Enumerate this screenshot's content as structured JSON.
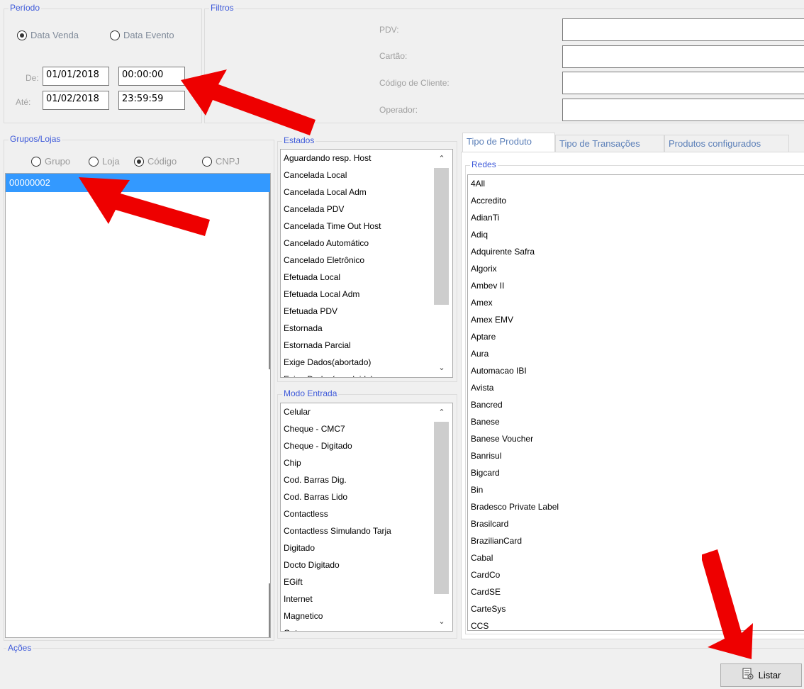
{
  "periodo": {
    "title": "Período",
    "options": [
      "Data Venda",
      "Data Evento"
    ],
    "selected": "Data Venda",
    "de_label": "De:",
    "ate_label": "Até:",
    "de_date": "01/01/2018",
    "de_time": "00:00:00",
    "ate_date": "01/02/2018",
    "ate_time": "23:59:59"
  },
  "filtros": {
    "title": "Filtros",
    "pdv_label": "PDV:",
    "cartao_label": "Cartão:",
    "codigo_label": "Código de Cliente:",
    "operador_label": "Operador:",
    "pdv_value": "",
    "cartao_value": "",
    "codigo_value": "",
    "operador_value": ""
  },
  "grupos": {
    "title": "Grupos/Lojas",
    "options": [
      "Grupo",
      "Loja",
      "Código",
      "CNPJ"
    ],
    "selected": "Código",
    "items": [
      "00000002"
    ]
  },
  "estados": {
    "title": "Estados",
    "items": [
      "Aguardando resp. Host",
      "Cancelada Local",
      "Cancelada Local Adm",
      "Cancelada PDV",
      "Cancelada Time Out Host",
      "Cancelado Automático",
      "Cancelado Eletrônico",
      "Efetuada Local",
      "Efetuada Local Adm",
      "Efetuada PDV",
      "Estornada",
      "Estornada Parcial",
      "Exige Dados(abortado)",
      "Exige Dados(concluido)"
    ]
  },
  "modo_entrada": {
    "title": "Modo Entrada",
    "items": [
      "Celular",
      "Cheque - CMC7",
      "Cheque - Digitado",
      "Chip",
      "Cod. Barras Dig.",
      "Cod. Barras Lido",
      "Contactless",
      "Contactless Simulando Tarja",
      "Digitado",
      "Docto Digitado",
      "EGift",
      "Internet",
      "Magnetico",
      "Outros"
    ]
  },
  "tabs": [
    "Tipo de Produto",
    "Tipo de Transações",
    "Produtos configurados"
  ],
  "redes": {
    "title": "Redes",
    "items": [
      "4All",
      "Accredito",
      "AdianTi",
      "Adiq",
      "Adquirente Safra",
      "Algorix",
      "Ambev II",
      "Amex",
      "Amex EMV",
      "Aptare",
      "Aura",
      "Automacao IBI",
      "Avista",
      "Bancred",
      "Banese",
      "Banese Voucher",
      "Banrisul",
      "Bigcard",
      "Bin",
      "Bradesco Private Label",
      "Brasilcard",
      "BrazilianCard",
      "Cabal",
      "CardCo",
      "CardSE",
      "CarteSys",
      "CCS"
    ]
  },
  "acoes": {
    "title": "Ações",
    "listar_label": "Listar"
  },
  "colors": {
    "selection": "#3399ff",
    "group_title": "#3d59d9",
    "annotation_arrow": "#ee0000"
  }
}
